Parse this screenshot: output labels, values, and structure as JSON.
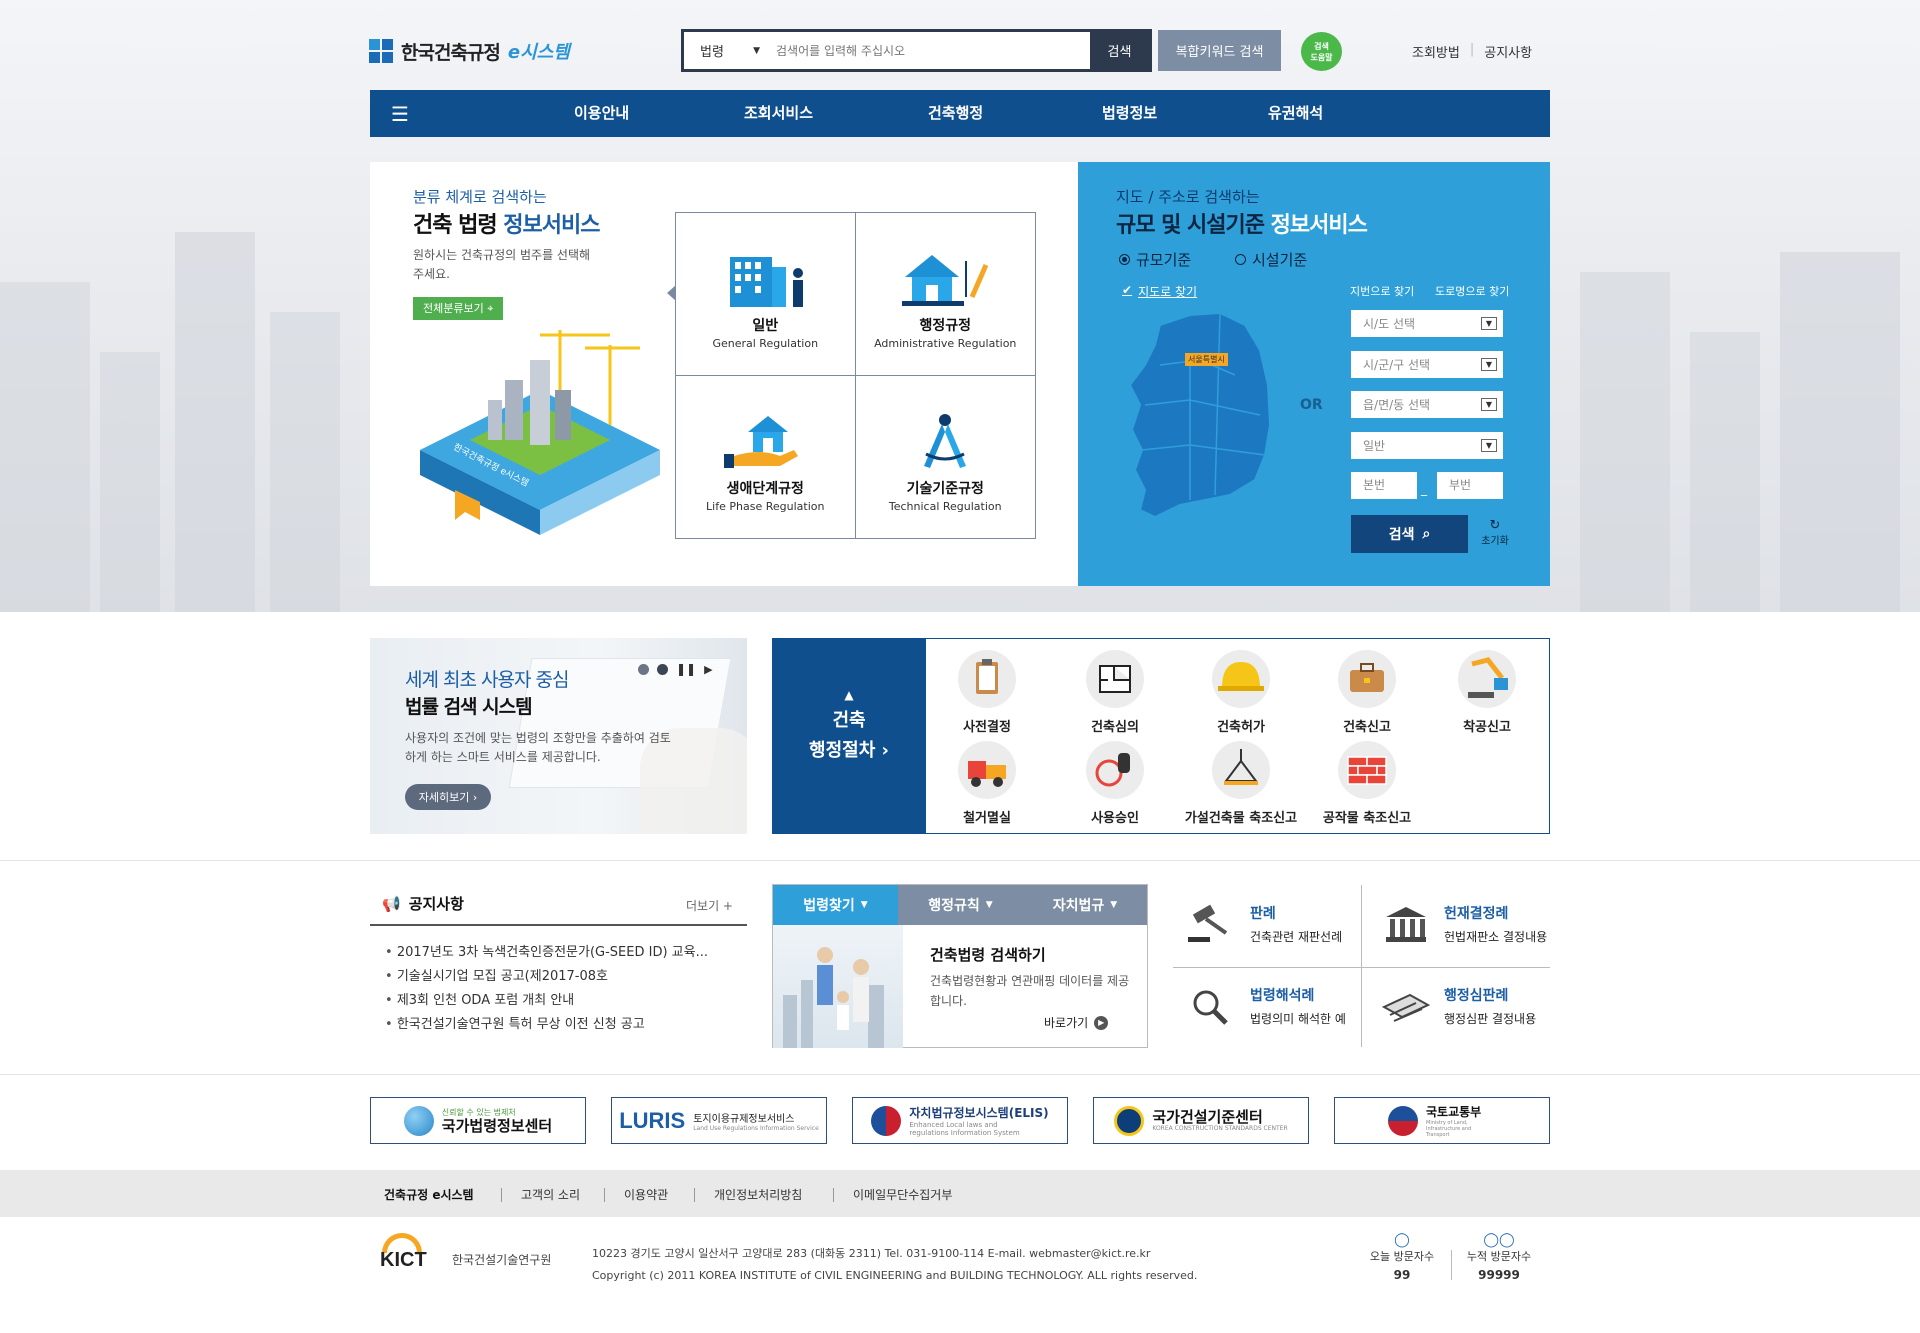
{
  "header": {
    "logo_text": "한국건축규정",
    "logo_e": "e시스템",
    "search_select": "법령",
    "search_placeholder": "검색어를 입력해 주십시오",
    "search_button": "검색",
    "complex_search": "복합키워드 검색",
    "help_bubble": "검색\n도움말",
    "links": [
      "조회방법",
      "공지사항"
    ]
  },
  "gnb": [
    "이용안내",
    "조회서비스",
    "건축행정",
    "법령정보",
    "유권해석"
  ],
  "left_panel": {
    "sub": "분류 체계로 검색하는",
    "title_a": "건축 법령 ",
    "title_b": "정보서비스",
    "desc": "원하시는 건축규정의 범주를 선택해주세요.",
    "tag": "전체분류보기",
    "book_text": "한국건축규정 e시스템",
    "cells": [
      {
        "ko": "일반",
        "en": "General Regulation",
        "icon": "building-icon"
      },
      {
        "ko": "행정규정",
        "en": "Administrative Regulation",
        "icon": "house-pencil-icon"
      },
      {
        "ko": "생애단계규정",
        "en": "Life Phase Regulation",
        "icon": "hand-house-icon"
      },
      {
        "ko": "기술기준규정",
        "en": "Technical Regulation",
        "icon": "compass-icon"
      }
    ]
  },
  "right_panel": {
    "sub": "지도 / 주소로 검색하는",
    "title_a": "규모 및 시설기준 ",
    "title_b": "정보서비스",
    "radio1": "규모기준",
    "radio2": "시설기준",
    "map_link": "지도로 찾기",
    "map_label": "서울특별시",
    "tab1": "지번으로 찾기",
    "tab2": "도로명으로 찾기",
    "or": "OR",
    "selects": [
      "시/도 선택",
      "시/군/구 선택",
      "읍/면/동 선택",
      "일반"
    ],
    "bonbun": "본번",
    "bubun": "부번",
    "dash": "_",
    "search": "검색",
    "reset": "초기화"
  },
  "promo": {
    "t1": "세계 최초 사용자 중심",
    "t2": "법률 검색 시스템",
    "desc": "사용자의 조건에 맞는 법령의 조항만을 추출하여 검토하게 하는 스마트 서비스를 제공합니다.",
    "btn": "자세히보기"
  },
  "procedure": {
    "title1": "건축",
    "title2": "행정절차",
    "items": [
      "사전결정",
      "건축심의",
      "건축허가",
      "건축신고",
      "착공신고",
      "철거멸실",
      "사용승인",
      "가설건축물 축조신고",
      "공작물 축조신고"
    ]
  },
  "notice": {
    "title": "공지사항",
    "more": "더보기 +",
    "items": [
      "2017년도 3차 녹색건축인증전문가(G-SEED ID) 교육...",
      "기술실시기업 모집 공고(제2017-08호",
      "제3회 인천 ODA 포럼 개최 안내",
      "한국건설기술연구원 특허 무상 이전 신청 공고"
    ]
  },
  "lawtabs": {
    "tabs": [
      "법령찾기",
      "행정규칙",
      "자치법규"
    ],
    "title": "건축법령 검색하기",
    "desc": "건축법령현황과 연관매핑 데이터를 제공합니다.",
    "go": "바로가기"
  },
  "cases": [
    {
      "t": "판례",
      "d": "건축관련 재판선례",
      "icon": "gavel-icon"
    },
    {
      "t": "헌재결정례",
      "d": "헌법재판소 결정내용",
      "icon": "court-icon"
    },
    {
      "t": "법령해석례",
      "d": "법령의미 해석한 예",
      "icon": "magnifier-icon"
    },
    {
      "t": "행정심판례",
      "d": "행정심판 결정내용",
      "icon": "document-icon"
    }
  ],
  "banners": [
    {
      "sub": "신뢰할 수 있는 법제처",
      "t": "국가법령정보센터",
      "color": "#2a86c8"
    },
    {
      "t": "LURIS",
      "t2": "토지이용규제정보서비스",
      "sub": "Land Use Regulations Information Service",
      "color": "#5f9b3c"
    },
    {
      "t": "자치법규정보시스템(ELIS)",
      "sub": "Enhanced Local laws and regulations Information System",
      "color": "#c8202f"
    },
    {
      "t": "국가건설기준센터",
      "sub": "KOREA CONSTRUCTION STANDARDS CENTER",
      "color": "#0c3f7a"
    },
    {
      "t": "국토교통부",
      "sub": "Ministry of Land, Infrastructure and Transport",
      "color": "#c8202f"
    }
  ],
  "footer": {
    "nav": [
      "건축규정 e시스템",
      "고객의 소리",
      "이용약관",
      "개인정보처리방침",
      "이메일무단수집거부"
    ],
    "org_logo": "KICT",
    "org_name": "한국건설기술연구원",
    "address": "10223 경기도 고양시 일산서구 고양대로 283 (대화동 2311) Tel. 031-9100-114 E-mail. webmaster@kict.re.kr",
    "copyright": "Copyright (c) 2011 KOREA INSTITUTE of CIVIL ENGINEERING and BUILDING TECHNOLOGY. ALL rights reserved.",
    "today_label": "오늘 방문자수",
    "today_value": "99",
    "total_label": "누적 방문자수",
    "total_value": "99999"
  }
}
